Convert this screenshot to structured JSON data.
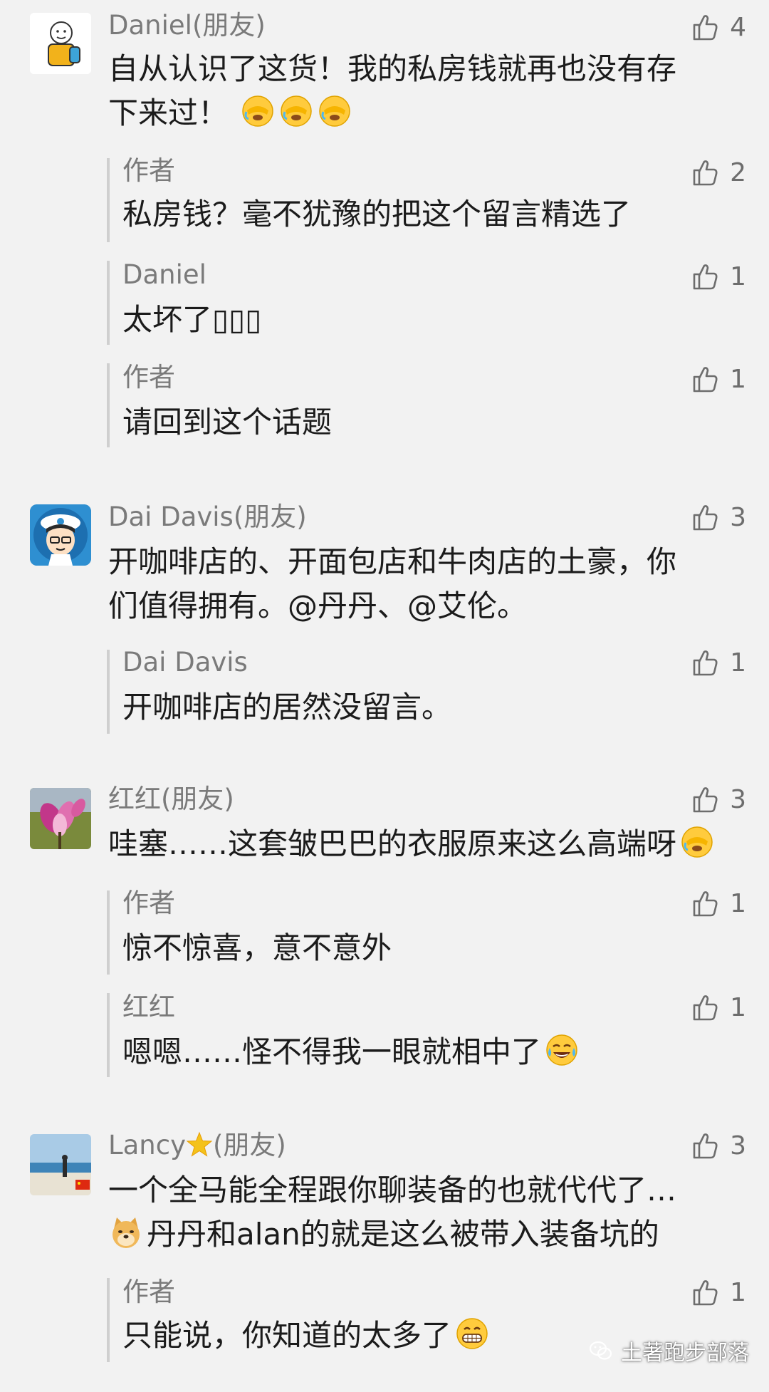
{
  "comments": [
    {
      "name": "Daniel(朋友)",
      "text_line1": "自从认识了这货！我的私房钱就再也没有存",
      "text_line2": "下来过！",
      "likes": "4",
      "avatar_icon": "cartoon-boy-avatar",
      "replies": [
        {
          "name": "作者",
          "text": "私房钱？毫不犹豫的把这个留言精选了",
          "likes": "2"
        },
        {
          "name": "Daniel",
          "text": "太坏了▯▯▯",
          "likes": "1"
        },
        {
          "name": "作者",
          "text": "请回到这个话题",
          "likes": "1"
        }
      ]
    },
    {
      "name": "Dai Davis(朋友)",
      "text_line1": "开咖啡店的、开面包店和牛肉店的土豪，你",
      "text_line2": "们值得拥有。@丹丹、@艾伦。",
      "likes": "3",
      "avatar_icon": "sailor-cartoon-avatar",
      "replies": [
        {
          "name": "Dai Davis",
          "text": "开咖啡店的居然没留言。",
          "likes": "1"
        }
      ]
    },
    {
      "name": "红红(朋友)",
      "text_line1": "哇塞……这套皱巴巴的衣服原来这么高端呀",
      "likes": "3",
      "avatar_icon": "magnolia-flower-avatar",
      "replies": [
        {
          "name": "作者",
          "text": "惊不惊喜，意不意外",
          "likes": "1"
        },
        {
          "name": "红红",
          "text": "嗯嗯……怪不得我一眼就相中了",
          "likes": "1"
        }
      ]
    },
    {
      "name": "Lancy",
      "name_suffix": "(朋友)",
      "text_line1": "一个全马能全程跟你聊装备的也就代代了…",
      "text_line2": "丹丹和alan的就是这么被带入装备坑的",
      "likes": "3",
      "avatar_icon": "beach-photo-avatar",
      "replies": [
        {
          "name": "作者",
          "text": "只能说，你知道的太多了",
          "likes": "1"
        }
      ]
    }
  ],
  "watermark": "土著跑步部落",
  "colors": {
    "background": "#f2f2f2",
    "name": "#7a7a7a",
    "text": "#1b1b1b",
    "reply_bar": "#cfcfcf",
    "like_icon": "#6d6d6d"
  }
}
